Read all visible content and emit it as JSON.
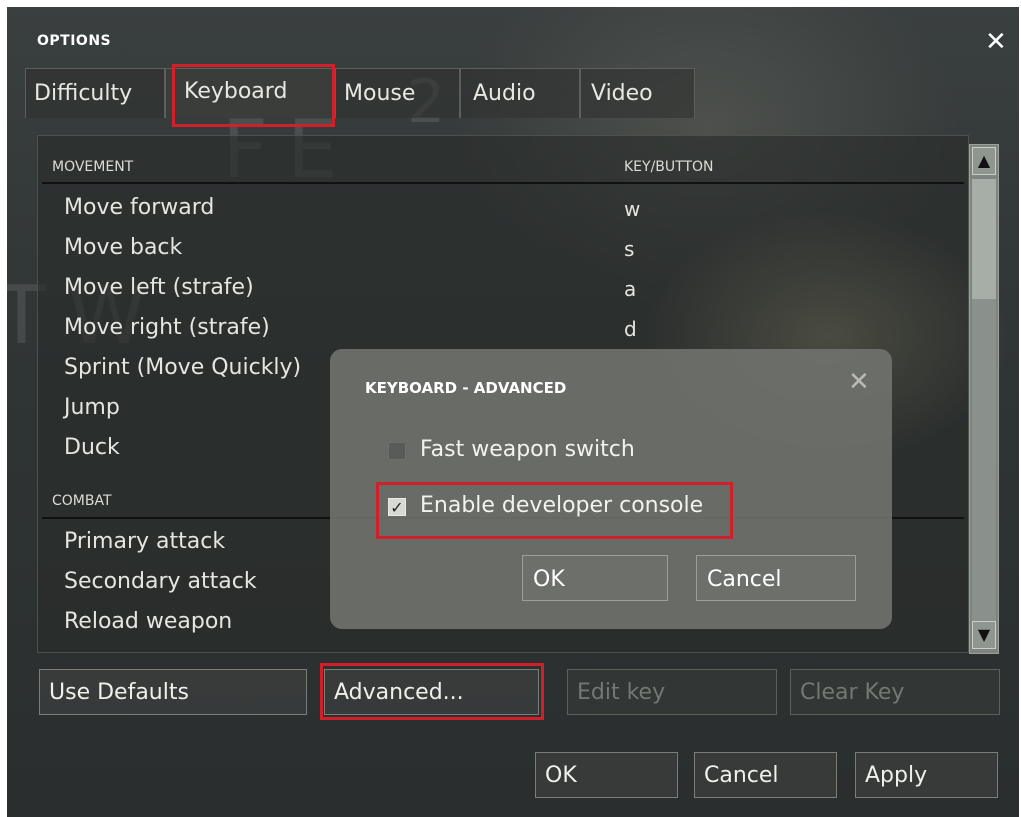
{
  "window": {
    "title": "OPTIONS",
    "close_icon": "close-icon"
  },
  "background": {
    "letters_top": [
      "F",
      "E",
      "2"
    ],
    "letters_side": [
      "T",
      "W"
    ]
  },
  "tabs": [
    {
      "label": "Difficulty",
      "active": false
    },
    {
      "label": "Keyboard",
      "active": true
    },
    {
      "label": "Mouse",
      "active": false
    },
    {
      "label": "Audio",
      "active": false
    },
    {
      "label": "Video",
      "active": false
    }
  ],
  "keyboard": {
    "movement_header": "MOVEMENT",
    "key_header": "KEY/BUTTON",
    "movement_rows": [
      {
        "action": "Move forward",
        "key": "w"
      },
      {
        "action": "Move back",
        "key": "s"
      },
      {
        "action": "Move left (strafe)",
        "key": "a"
      },
      {
        "action": "Move right (strafe)",
        "key": "d"
      },
      {
        "action": "Sprint (Move Quickly)",
        "key": ""
      },
      {
        "action": "Jump",
        "key": ""
      },
      {
        "action": "Duck",
        "key": ""
      }
    ],
    "combat_header": "COMBAT",
    "combat_rows": [
      {
        "action": "Primary attack",
        "key": ""
      },
      {
        "action": "Secondary attack",
        "key": ""
      },
      {
        "action": "Reload weapon",
        "key": ""
      }
    ],
    "buttons": {
      "use_defaults": "Use Defaults",
      "advanced": "Advanced...",
      "edit_key": "Edit key",
      "clear_key": "Clear Key"
    }
  },
  "footer": {
    "ok": "OK",
    "cancel": "Cancel",
    "apply": "Apply"
  },
  "advanced_dialog": {
    "title": "KEYBOARD - ADVANCED",
    "options": [
      {
        "label": "Fast weapon switch",
        "checked": false
      },
      {
        "label": "Enable developer console",
        "checked": true
      }
    ],
    "ok": "OK",
    "cancel": "Cancel"
  },
  "colors": {
    "highlight": "#d0202a",
    "text": "#e6e6e0"
  }
}
